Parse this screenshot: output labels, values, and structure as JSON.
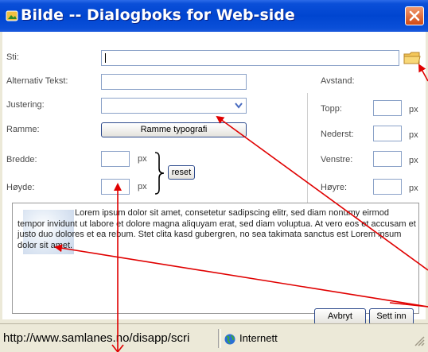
{
  "dialog": {
    "title": "Bilde -- Dialogboks for Web-side"
  },
  "form": {
    "path_label": "Sti:",
    "path_value": "",
    "alt_label": "Alternativ Tekst:",
    "alt_value": "",
    "align_label": "Justering:",
    "align_value": "",
    "border_label": "Ramme:",
    "border_button": "Ramme typografi",
    "width_label": "Bredde:",
    "height_label": "Høyde:",
    "unit": "px",
    "reset_button": "reset"
  },
  "spacing": {
    "heading": "Avstand:",
    "top_label": "Topp:",
    "bottom_label": "Nederst:",
    "left_label": "Venstre:",
    "right_label": "Høyre:",
    "unit": "px"
  },
  "preview": {
    "text": "Lorem ipsum dolor sit amet, consetetur sadipscing elitr, sed diam nonumy eirmod tempor invidunt ut labore et dolore magna aliquyam erat, sed diam voluptua. At vero eos et accusam et justo duo dolores et ea rebum. Stet clita kasd gubergren, no sea takimata sanctus est Lorem ipsum dolor sit amet."
  },
  "buttons": {
    "cancel": "Avbryt",
    "insert": "Sett inn"
  },
  "statusbar": {
    "url": "http://www.samlanes.no/disapp/scri",
    "zone": "Internett"
  },
  "colors": {
    "titlebar": "#0045d0",
    "close": "#d24a14",
    "annotation_arrows": "#e00000"
  }
}
